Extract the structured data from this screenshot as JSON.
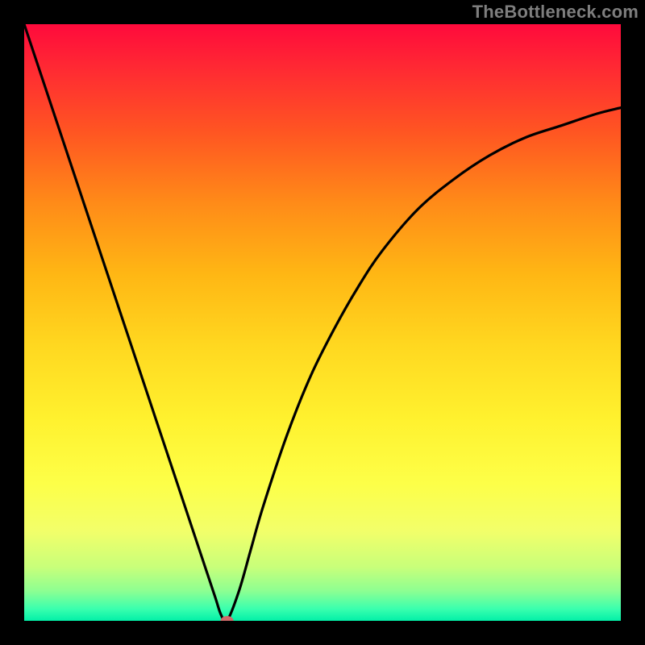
{
  "watermark": "TheBottleneck.com",
  "chart_data": {
    "type": "line",
    "title": "",
    "xlabel": "",
    "ylabel": "",
    "xlim": [
      0,
      100
    ],
    "ylim": [
      0,
      100
    ],
    "grid": false,
    "legend": false,
    "series": [
      {
        "name": "bottleneck-curve",
        "x": [
          0,
          4,
          8,
          12,
          16,
          20,
          24,
          28,
          30,
          32,
          33,
          34,
          36,
          38,
          40,
          44,
          48,
          52,
          56,
          60,
          66,
          72,
          78,
          84,
          90,
          96,
          100
        ],
        "y": [
          100,
          88,
          76,
          64,
          52,
          40,
          28,
          16,
          10,
          4,
          1,
          0,
          5,
          12,
          19,
          31,
          41,
          49,
          56,
          62,
          69,
          74,
          78,
          81,
          83,
          85,
          86
        ]
      }
    ],
    "min_marker": {
      "x": 34,
      "y": 0,
      "color": "#d06a6a"
    },
    "colors": {
      "curve": "#000000",
      "background_frame": "#000000",
      "gradient_top": "#ff0a3c",
      "gradient_mid": "#ffd820",
      "gradient_bot": "#02f0a8"
    }
  }
}
